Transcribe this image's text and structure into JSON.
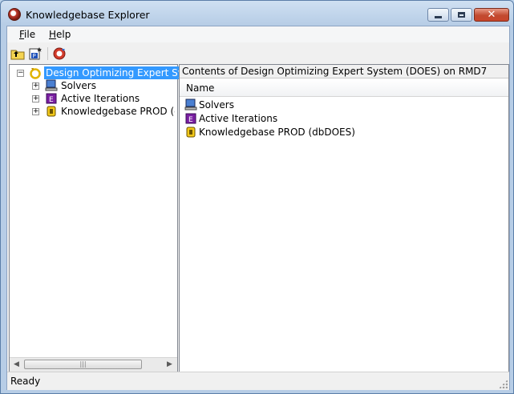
{
  "window": {
    "title": "Knowledgebase Explorer"
  },
  "menubar": {
    "items": [
      {
        "label": "File",
        "underline": "F",
        "rest": "ile"
      },
      {
        "label": "Help",
        "underline": "H",
        "rest": "elp"
      }
    ]
  },
  "toolbar": {
    "buttons": [
      {
        "icon": "folder-up-icon"
      },
      {
        "icon": "properties-icon"
      },
      {
        "icon": "refresh-icon"
      }
    ]
  },
  "tree": {
    "root": {
      "label": "Design Optimizing Expert System (I",
      "icon": "does-system-icon",
      "expanded": true,
      "selected": true
    },
    "children": [
      {
        "label": "Solvers",
        "icon": "computer-icon"
      },
      {
        "label": "Active Iterations",
        "icon": "iterations-e-icon"
      },
      {
        "label": "Knowledgebase PROD (dbDO",
        "icon": "database-icon"
      }
    ]
  },
  "content": {
    "path_title": "Contents of Design Optimizing Expert System (DOES) on RMD7",
    "column_header": "Name",
    "items": [
      {
        "label": "Solvers",
        "icon": "computer-icon"
      },
      {
        "label": "Active Iterations",
        "icon": "iterations-e-icon"
      },
      {
        "label": "Knowledgebase PROD (dbDOES)",
        "icon": "database-icon"
      }
    ]
  },
  "status": {
    "text": "Ready"
  },
  "colors": {
    "selection": "#3399ff",
    "title_gradient": "#cfe0f2",
    "iterations_icon": "#7a1fa2"
  }
}
